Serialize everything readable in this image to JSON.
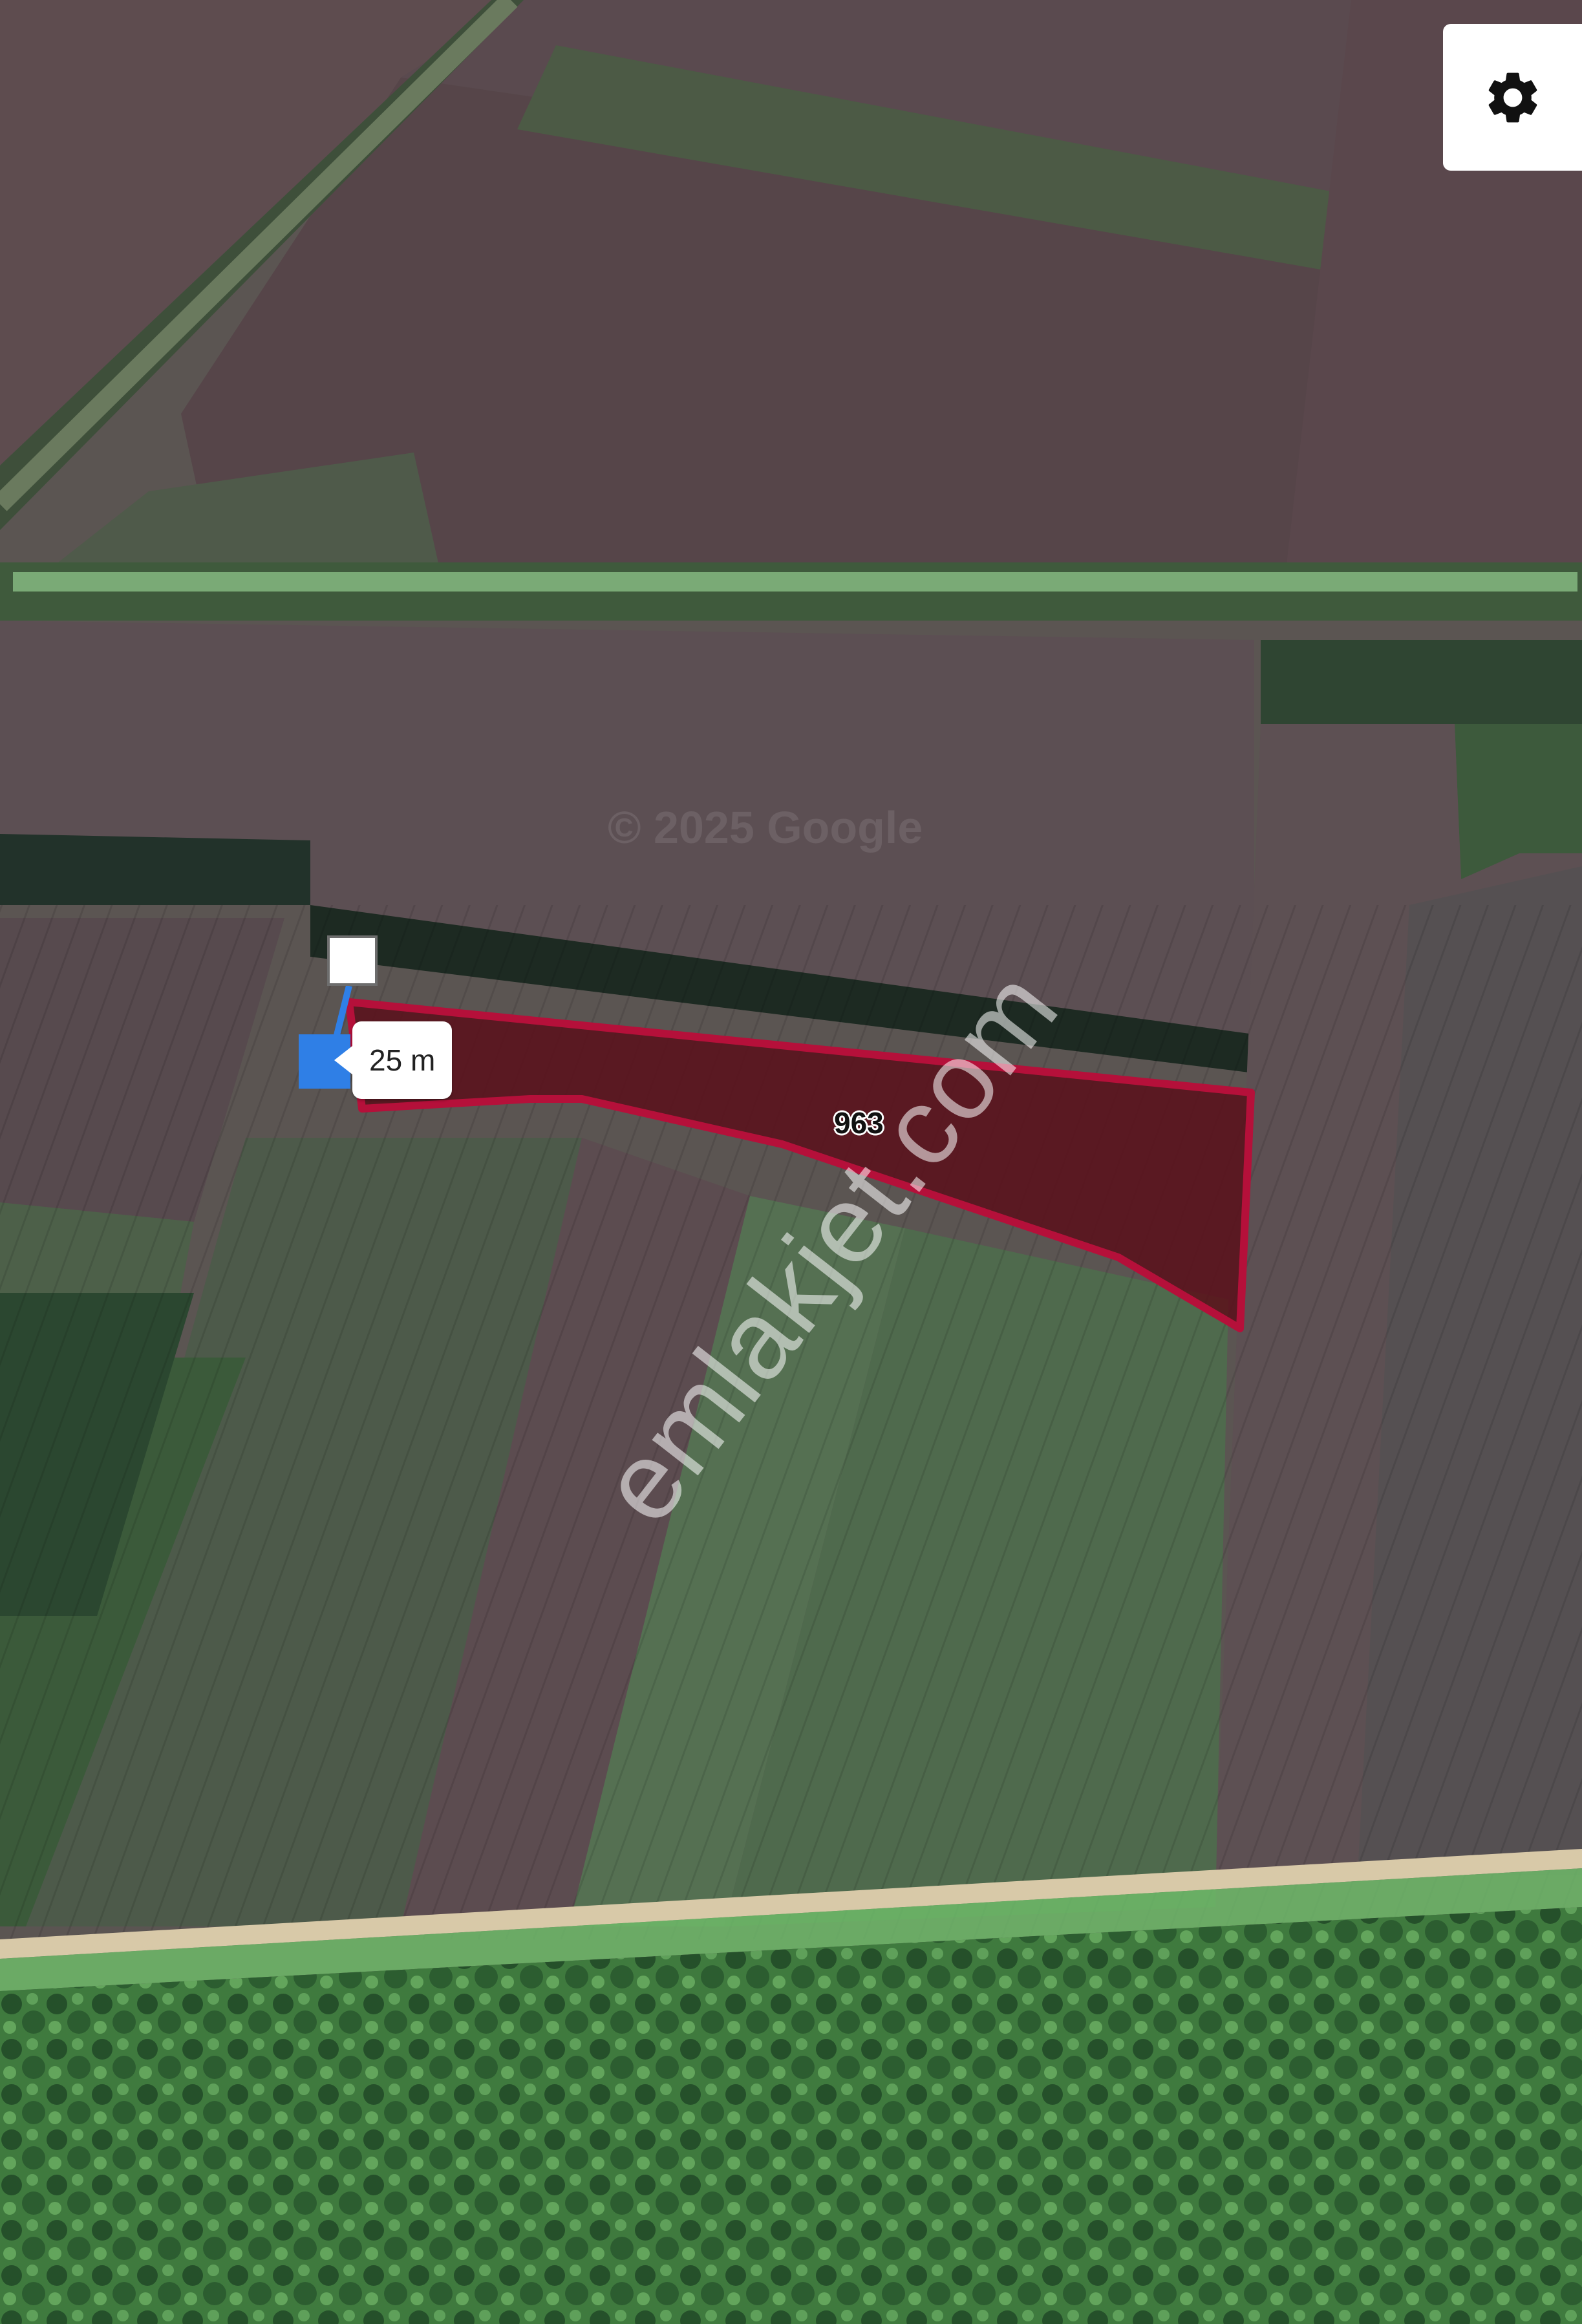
{
  "map": {
    "distance_label": "25 m",
    "parcel_number": "963",
    "site_watermark": "emlakjet.com",
    "imagery_watermark": "© 2025 Google",
    "colors": {
      "parcel_outline": "#b5103a",
      "parcel_fill": "#5a0f1a",
      "marker_blue": "#2f7fe6"
    }
  },
  "controls": {
    "settings_icon": "gear-icon"
  }
}
